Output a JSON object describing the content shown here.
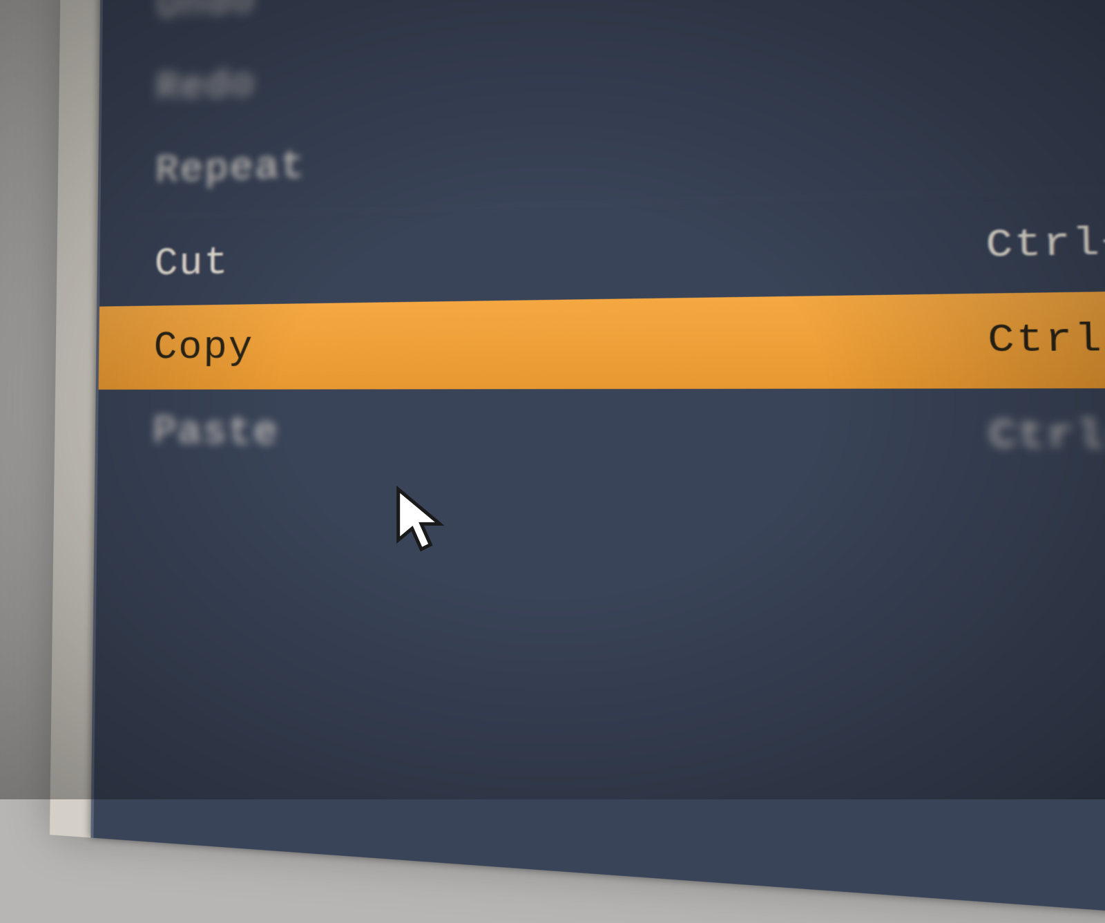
{
  "menu": {
    "items": [
      {
        "label": "Undo",
        "shortcut": "",
        "highlighted": false
      },
      {
        "label": "Redo",
        "shortcut": "",
        "highlighted": false
      },
      {
        "label": "Repeat",
        "shortcut": "",
        "highlighted": false
      },
      {
        "label": "Cut",
        "shortcut": "Ctrl+X",
        "highlighted": false
      },
      {
        "label": "Copy",
        "shortcut": "Ctrl+C",
        "highlighted": true
      },
      {
        "label": "Paste",
        "shortcut": "Ctrl+V",
        "highlighted": false
      }
    ]
  },
  "colors": {
    "menu_bg": "#3a4458",
    "menu_text": "#e8e4d8",
    "highlight_bg": "#f0a038",
    "highlight_text": "#2a2418"
  }
}
